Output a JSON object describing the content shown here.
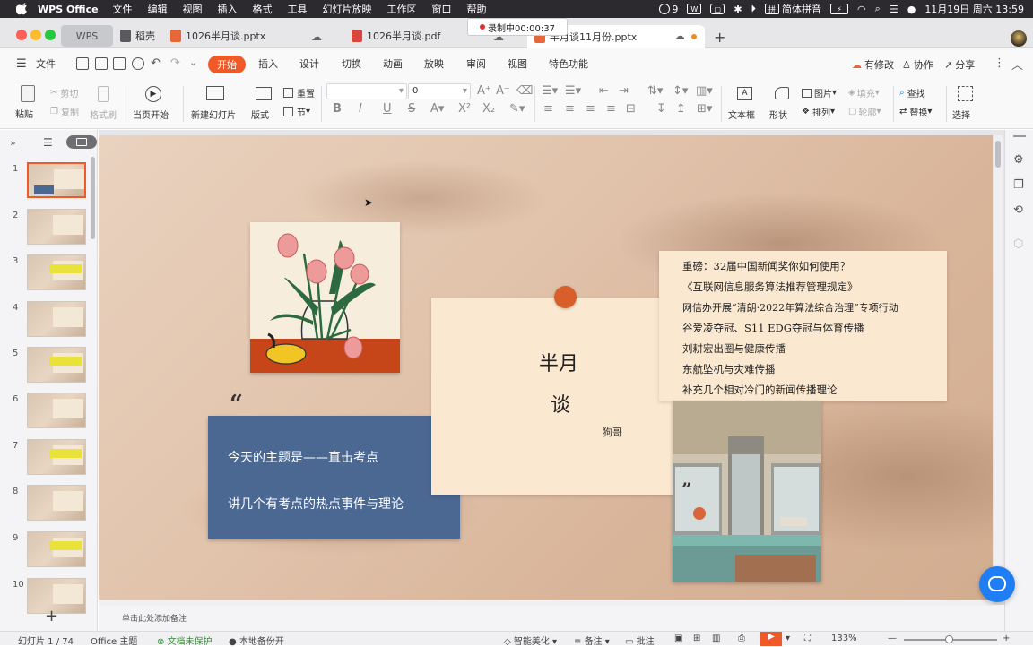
{
  "menubar": {
    "app_name": "WPS Office",
    "items": [
      "文件",
      "编辑",
      "视图",
      "插入",
      "格式",
      "工具",
      "幻灯片放映",
      "工作区",
      "窗口",
      "帮助"
    ],
    "status": {
      "count_badge": "9",
      "input_method": "简体拼音",
      "datetime": "11月19日 周六  13:59"
    }
  },
  "tabs": {
    "home": "WPS",
    "docer": "稻壳",
    "items": [
      {
        "label": "1026半月谈.pptx"
      },
      {
        "label": "1026半月谈.pdf"
      },
      {
        "label": "半月谈11月份.pptx"
      }
    ],
    "new_tab": "+"
  },
  "recording": {
    "label": "录制中00:00:37"
  },
  "ribbon": {
    "file_menu": "文件",
    "tabs": [
      "开始",
      "插入",
      "设计",
      "切换",
      "动画",
      "放映",
      "审阅",
      "视图",
      "特色功能"
    ],
    "active_tab": "开始",
    "right": {
      "changes": "有修改",
      "collab": "协作",
      "share": "分享"
    }
  },
  "toolbar": {
    "paste": "粘贴",
    "cut": "剪切",
    "copy": "复制",
    "format_painter": "格式刷",
    "play_current": "当页开始",
    "new_slide": "新建幻灯片",
    "layout": "版式",
    "reset": "重置",
    "section": "节",
    "font_name": "",
    "font_size": "0",
    "textbox": "文本框",
    "shape": "形状",
    "picture": "图片",
    "fill": "填充",
    "arrange": "排列",
    "outline": "轮廓",
    "find": "查找",
    "replace": "替换",
    "select": "选择"
  },
  "thumbnails": [
    "1",
    "2",
    "3",
    "4",
    "5",
    "6",
    "7",
    "8",
    "9",
    "10"
  ],
  "slide": {
    "open_quote": "“",
    "close_quote": "”",
    "title_line1": "半月",
    "title_line2": "谈",
    "author": "狗哥",
    "blue_box_line1": "今天的主题是——直击考点",
    "blue_box_line2": "讲几个有考点的热点事件与理论",
    "topics": [
      "重磅：32届中国新闻奖你如何使用？",
      "《互联网信息服务算法推荐管理规定》",
      "网信办开展“清朗·2022年算法综合治理”专项行动",
      "谷爱凌夺冠、S11 EDG夺冠与体育传播",
      "刘耕宏出圈与健康传播",
      "东航坠机与灾难传播",
      "补充几个相对冷门的新闻传播理论"
    ]
  },
  "notes": {
    "placeholder": "单击此处添加备注"
  },
  "statusbar": {
    "slide_pos": "幻灯片 1 / 74",
    "theme": "Office 主题",
    "protect": "文档未保护",
    "backup": "本地备份开",
    "beautify": "智能美化",
    "notes": "备注",
    "comments": "批注",
    "zoom": "133%"
  }
}
